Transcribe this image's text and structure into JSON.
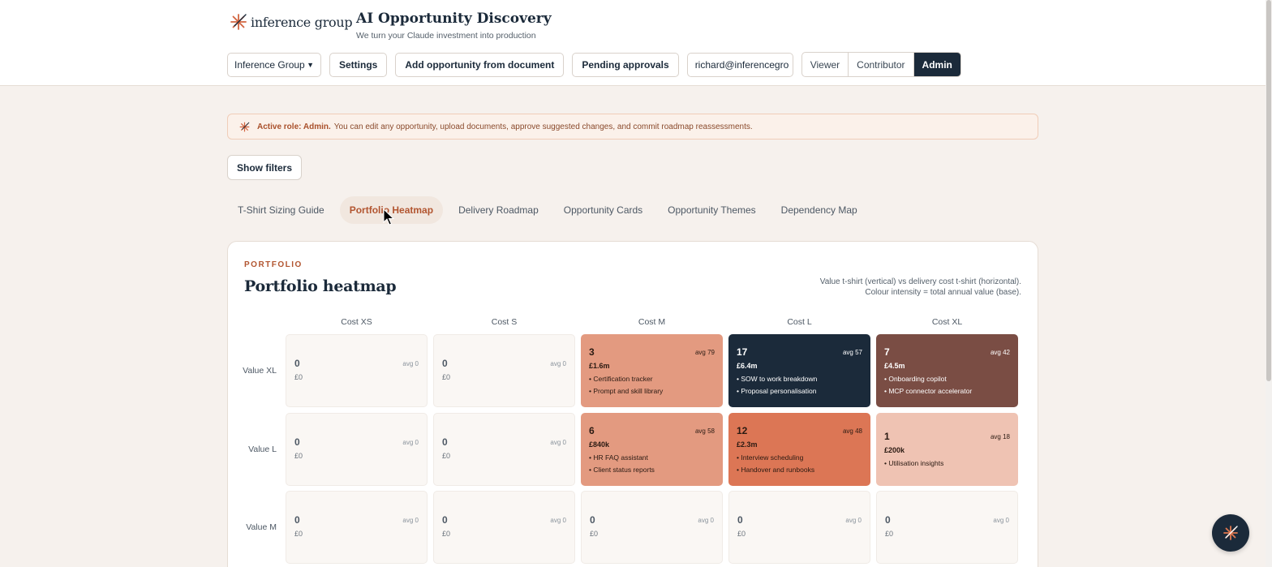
{
  "brand": {
    "name": "inference group",
    "icon": "asterisk-spark-icon"
  },
  "app": {
    "title": "AI Opportunity Discovery",
    "subtitle": "We turn your Claude investment into production"
  },
  "toolbar": {
    "org_select": "Inference Group",
    "settings": "Settings",
    "add_opportunity": "Add opportunity from document",
    "pending": "Pending approvals",
    "email": "richard@inferencegro",
    "roles": [
      "Viewer",
      "Contributor",
      "Admin"
    ],
    "active_role": "Admin"
  },
  "notice": {
    "label": "Active role: Admin.",
    "text": "You can edit any opportunity, upload documents, approve suggested changes, and commit roadmap reassessments."
  },
  "filters": {
    "label": "Show filters"
  },
  "tabs": [
    "T-Shirt Sizing Guide",
    "Portfolio Heatmap",
    "Delivery Roadmap",
    "Opportunity Cards",
    "Opportunity Themes",
    "Dependency Map"
  ],
  "active_tab": "Portfolio Heatmap",
  "panel": {
    "eyebrow": "PORTFOLIO",
    "title": "Portfolio heatmap",
    "legend_line1": "Value t-shirt (vertical) vs delivery cost t-shirt (horizontal).",
    "legend_line2": "Colour intensity = total annual value (base)."
  },
  "heatmap": {
    "cols": [
      "Cost XS",
      "Cost S",
      "Cost M",
      "Cost L",
      "Cost XL"
    ],
    "rows": [
      {
        "label": "Value XL",
        "cells": [
          {
            "count": "0",
            "avg": "avg 0",
            "value": "£0",
            "items": [],
            "bg": "#faf7f4",
            "fg": "#4d5864"
          },
          {
            "count": "0",
            "avg": "avg 0",
            "value": "£0",
            "items": [],
            "bg": "#faf7f4",
            "fg": "#4d5864"
          },
          {
            "count": "3",
            "avg": "avg 79",
            "value": "£1.6m",
            "items": [
              "• Certification tracker",
              "• Prompt and skill library"
            ],
            "bg": "#e39a80",
            "fg": "#2a1a12"
          },
          {
            "count": "17",
            "avg": "avg 57",
            "value": "£6.4m",
            "items": [
              "• SOW to work breakdown",
              "• Proposal personalisation"
            ],
            "bg": "#1b2a3a",
            "fg": "#ffffff"
          },
          {
            "count": "7",
            "avg": "avg 42",
            "value": "£4.5m",
            "items": [
              "• Onboarding copilot",
              "• MCP connector accelerator"
            ],
            "bg": "#7a4d44",
            "fg": "#ffffff"
          }
        ]
      },
      {
        "label": "Value L",
        "cells": [
          {
            "count": "0",
            "avg": "avg 0",
            "value": "£0",
            "items": [],
            "bg": "#faf7f4",
            "fg": "#4d5864"
          },
          {
            "count": "0",
            "avg": "avg 0",
            "value": "£0",
            "items": [],
            "bg": "#faf7f4",
            "fg": "#4d5864"
          },
          {
            "count": "6",
            "avg": "avg 58",
            "value": "£840k",
            "items": [
              "• HR FAQ assistant",
              "• Client status reports"
            ],
            "bg": "#e39a80",
            "fg": "#2a1a12"
          },
          {
            "count": "12",
            "avg": "avg 48",
            "value": "£2.3m",
            "items": [
              "• Interview scheduling",
              "• Handover and runbooks"
            ],
            "bg": "#dc7655",
            "fg": "#2a1a12"
          },
          {
            "count": "1",
            "avg": "avg 18",
            "value": "£200k",
            "items": [
              "• Utilisation insights"
            ],
            "bg": "#efc3b3",
            "fg": "#2a1a12"
          }
        ]
      },
      {
        "label": "Value M",
        "cells": [
          {
            "count": "0",
            "avg": "avg 0",
            "value": "£0",
            "items": [],
            "bg": "#faf7f4",
            "fg": "#4d5864"
          },
          {
            "count": "0",
            "avg": "avg 0",
            "value": "£0",
            "items": [],
            "bg": "#faf7f4",
            "fg": "#4d5864"
          },
          {
            "count": "0",
            "avg": "avg 0",
            "value": "£0",
            "items": [],
            "bg": "#faf7f4",
            "fg": "#4d5864"
          },
          {
            "count": "0",
            "avg": "avg 0",
            "value": "£0",
            "items": [],
            "bg": "#faf7f4",
            "fg": "#4d5864"
          },
          {
            "count": "0",
            "avg": "avg 0",
            "value": "£0",
            "items": [],
            "bg": "#faf7f4",
            "fg": "#4d5864"
          }
        ]
      }
    ]
  },
  "fab": {
    "icon": "assistant-spark-icon"
  }
}
